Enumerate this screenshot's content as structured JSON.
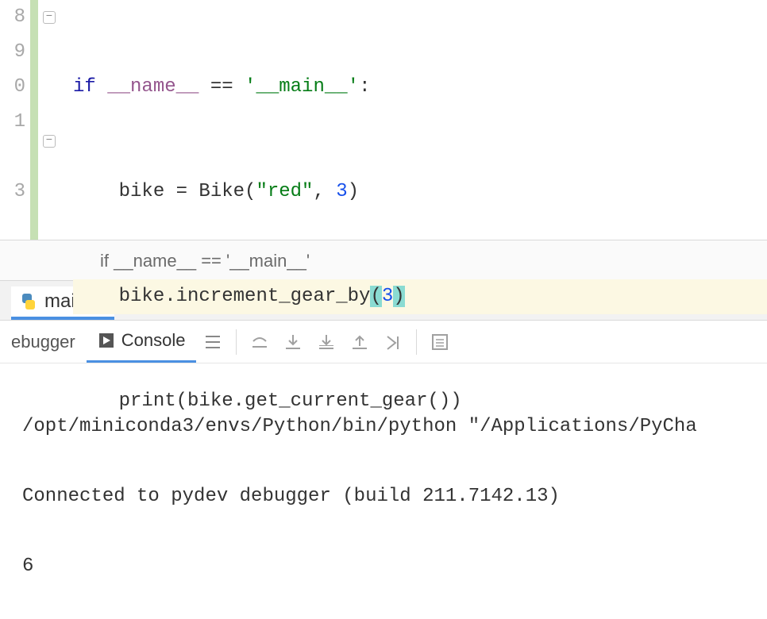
{
  "editor": {
    "line_numbers": [
      "8",
      "9",
      "0",
      "1",
      "",
      "3"
    ],
    "code": {
      "l1_if": "if",
      "l1_name": "__name__",
      "l1_eq": " == ",
      "l1_str": "'__main__'",
      "l1_colon": ":",
      "l2": "    bike = Bike(",
      "l2_str": "\"red\"",
      "l2_after": ", ",
      "l2_num": "3",
      "l2_close": ")",
      "l3_pre": "    bike.increment_gear_by",
      "l3_open": "(",
      "l3_arg": "3",
      "l3_close": ")",
      "l4_pre": "    ",
      "l4_print": "print",
      "l4_rest": "(bike.get_current_gear())"
    }
  },
  "breadcrumb": "if __name__ == '__main__'",
  "tab": {
    "name": "main"
  },
  "toolbar": {
    "debugger": "ebugger",
    "console": "Console"
  },
  "console": {
    "line1": "/opt/miniconda3/envs/Python/bin/python \"/Applications/PyCha",
    "line2": "Connected to pydev debugger (build 211.7142.13)",
    "line3": "6"
  }
}
